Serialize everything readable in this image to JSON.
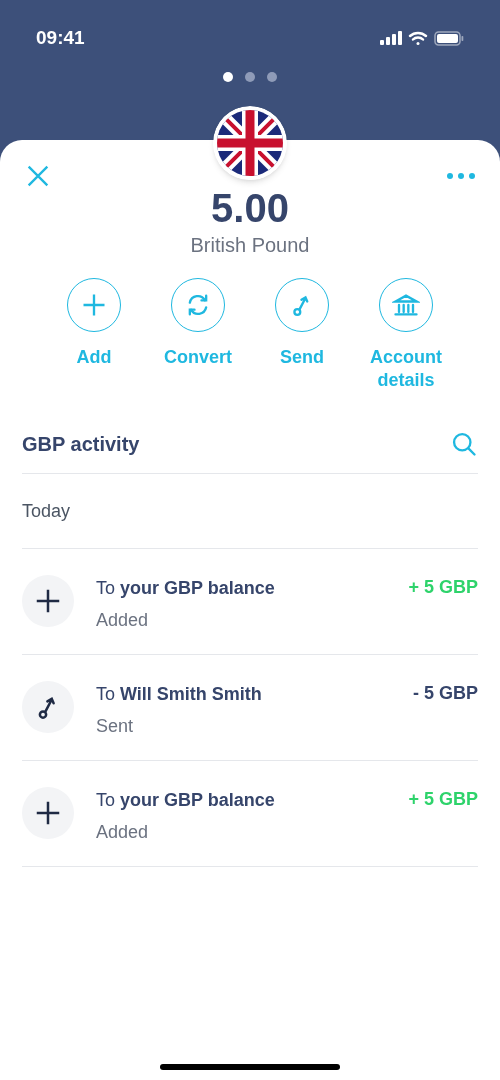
{
  "status_bar": {
    "time": "09:41"
  },
  "pager": [
    {
      "selected": true
    },
    {
      "selected": false
    },
    {
      "selected": false
    }
  ],
  "balance": {
    "amount": "5.00",
    "currency": "British Pound"
  },
  "actions": [
    {
      "kind": "add",
      "label": "Add"
    },
    {
      "kind": "convert",
      "label": "Convert"
    },
    {
      "kind": "send",
      "label": "Send"
    },
    {
      "kind": "bank",
      "label": "Account details"
    }
  ],
  "activity": {
    "title": "GBP activity",
    "group": "Today",
    "transactions": [
      {
        "kind": "add",
        "title": "To **your GBP balance**",
        "status": "Added",
        "amount": "+ 5 GBP",
        "credit": true
      },
      {
        "kind": "send",
        "title": "To **Will Smith Smith**",
        "status": "Sent",
        "amount": "- 5 GBP",
        "credit": false
      },
      {
        "kind": "add",
        "title": "To **your GBP balance**",
        "status": "Added",
        "amount": "+ 5 GBP",
        "credit": true
      }
    ]
  }
}
